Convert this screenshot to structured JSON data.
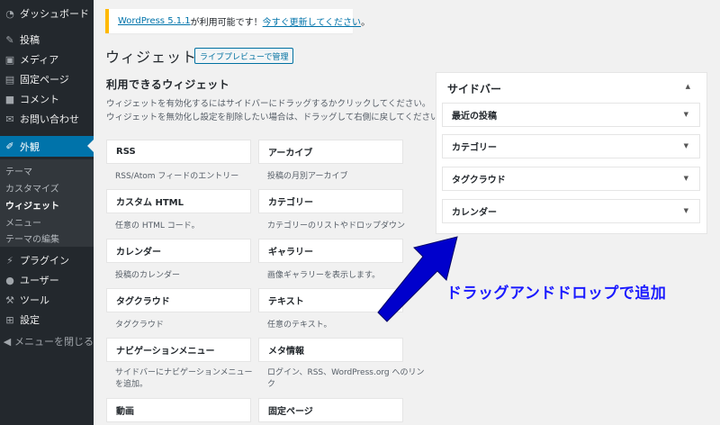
{
  "admin_menu": {
    "dashboard": "ダッシュボード",
    "posts": "投稿",
    "media": "メディア",
    "pages": "固定ページ",
    "comments": "コメント",
    "contact": "お問い合わせ",
    "appearance": "外観",
    "appearance_sub": [
      "テーマ",
      "カスタマイズ",
      "ウィジェット",
      "メニュー",
      "テーマの編集"
    ],
    "plugins": "プラグイン",
    "users": "ユーザー",
    "tools": "ツール",
    "settings": "設定",
    "collapse": "メニューを閉じる"
  },
  "notice": {
    "link_version": "WordPress 5.1.1",
    "text_middle": " が利用可能です！",
    "link_update": "今すぐ更新してください",
    "text_end": "。",
    "border_color": "#ffb900"
  },
  "page": {
    "title": "ウィジェット",
    "manage_button": "ライブプレビューで管理",
    "available_heading": "利用できるウィジェット",
    "description_line1": "ウィジェットを有効化するにはサイドバーにドラッグするかクリックしてください。",
    "description_line2": "ウィジェットを無効化し設定を削除したい場合は、ドラッグして右側に戻してください。"
  },
  "widgets": [
    {
      "title": "RSS",
      "desc": "RSS/Atom フィードのエントリー"
    },
    {
      "title": "アーカイブ",
      "desc": "投稿の月別アーカイブ"
    },
    {
      "title": "カスタム HTML",
      "desc": "任意の HTML コード。"
    },
    {
      "title": "カテゴリー",
      "desc": "カテゴリーのリストやドロップダウン"
    },
    {
      "title": "カレンダー",
      "desc": "投稿のカレンダー"
    },
    {
      "title": "ギャラリー",
      "desc": "画像ギャラリーを表示します。"
    },
    {
      "title": "タグクラウド",
      "desc": "タグクラウド"
    },
    {
      "title": "テキスト",
      "desc": "任意のテキスト。"
    },
    {
      "title": "ナビゲーションメニュー",
      "desc_line1": "サイドバーにナビゲーションメニュー",
      "desc_line2": "を追加。"
    },
    {
      "title": "メタ情報",
      "desc_line1": "ログイン、RSS、WordPress.org へのリン",
      "desc_line2": "ク"
    },
    {
      "title": "動画"
    },
    {
      "title": "固定ページ"
    }
  ],
  "sidebar_area": {
    "title": "サイドバー",
    "widgets": [
      "最近の投稿",
      "カテゴリー",
      "タグクラウド",
      "カレンダー"
    ]
  },
  "annotation": {
    "text": "ドラッグアンドドロップで追加",
    "color": "#1a1aff",
    "arrow_color": "#0000cc"
  },
  "colors": {
    "admin_bar": "#23282d",
    "active_menu": "#0073aa",
    "link": "#0073aa"
  },
  "icons": {
    "dashboard": "gauge-icon",
    "posts": "pin-icon",
    "media": "media-icon",
    "pages": "pages-icon",
    "comments": "comment-icon",
    "contact": "mail-icon",
    "appearance": "brush-icon",
    "plugins": "plug-icon",
    "users": "user-icon",
    "tools": "wrench-icon",
    "settings": "settings-icon",
    "collapse": "collapse-icon"
  }
}
